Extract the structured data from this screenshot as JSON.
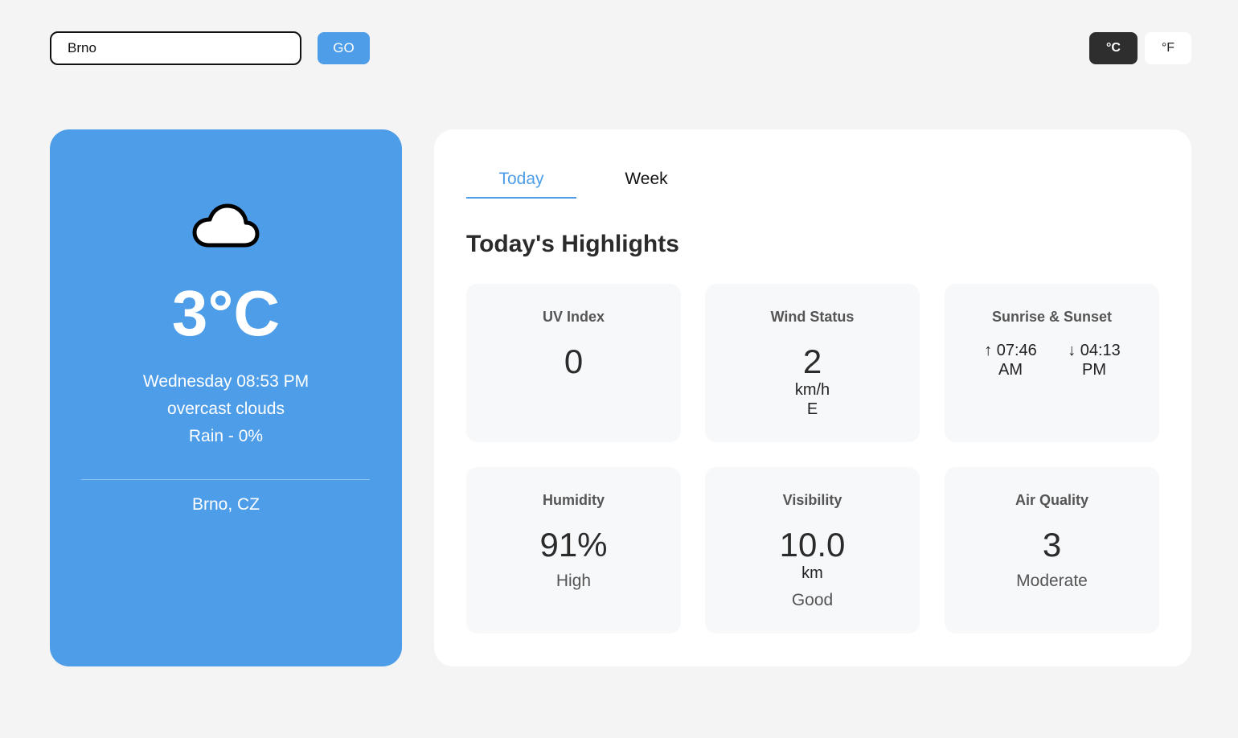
{
  "search": {
    "value": "Brno",
    "go_label": "GO"
  },
  "units": {
    "celsius": "°C",
    "fahrenheit": "°F",
    "active": "celsius"
  },
  "current": {
    "icon": "cloud-icon",
    "temperature": "3°C",
    "datetime": "Wednesday 08:53 PM",
    "description": "overcast clouds",
    "rain": "Rain - 0%",
    "location": "Brno, CZ"
  },
  "tabs": [
    {
      "label": "Today",
      "active": true
    },
    {
      "label": "Week",
      "active": false
    }
  ],
  "highlights_title": "Today's Highlights",
  "highlights": {
    "uv": {
      "title": "UV Index",
      "value": "0"
    },
    "wind": {
      "title": "Wind Status",
      "value": "2",
      "unit": "km/h",
      "direction": "E"
    },
    "sun": {
      "title": "Sunrise & Sunset",
      "sunrise_arrow": "↑",
      "sunrise_time": "07:46",
      "sunrise_period": "AM",
      "sunset_arrow": "↓",
      "sunset_time": "04:13",
      "sunset_period": "PM"
    },
    "humidity": {
      "title": "Humidity",
      "value": "91%",
      "note": "High"
    },
    "visibility": {
      "title": "Visibility",
      "value": "10.0",
      "unit": "km",
      "note": "Good"
    },
    "air": {
      "title": "Air Quality",
      "value": "3",
      "note": "Moderate"
    }
  },
  "colors": {
    "accent": "#4d9de8",
    "dark_button": "#2e2e2e",
    "background": "#f4f4f4",
    "card": "#f7f8fa"
  }
}
